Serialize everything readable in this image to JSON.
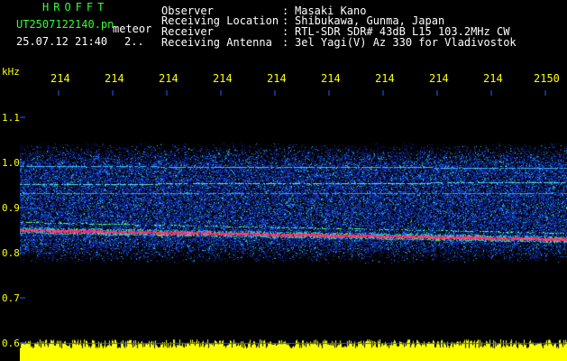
{
  "header": {
    "app_title": "HROFFT",
    "filename": "UT2507122140.pn",
    "mode": "meteor",
    "datetime": "25.07.12 21:40",
    "extra": "2.."
  },
  "meta": [
    {
      "label": "Observer",
      "value": "Masaki Kano"
    },
    {
      "label": "Receiving Location",
      "value": "Shibukawa, Gunma, Japan"
    },
    {
      "label": "Receiver",
      "value": "RTL-SDR SDR# 43dB L15 103.2MHz CW"
    },
    {
      "label": "Receiving Antenna",
      "value": "3el Yagi(V) Az 330 for Vladivostok"
    }
  ],
  "axes": {
    "y_unit": "kHz",
    "y_ticks": [
      "1.1",
      "1.0",
      "0.9",
      "0.8",
      "0.7",
      "0.6"
    ],
    "x_ticks": [
      "214",
      "214",
      "214",
      "214",
      "214",
      "214",
      "214",
      "214",
      "214",
      "2150"
    ]
  },
  "colors": {
    "header_green": "#33ff33",
    "axis_yellow": "#ffff00",
    "tick_cyan": "#2060ff",
    "noise_blue": "#1030c0",
    "echo_red": "#ff2060"
  }
}
